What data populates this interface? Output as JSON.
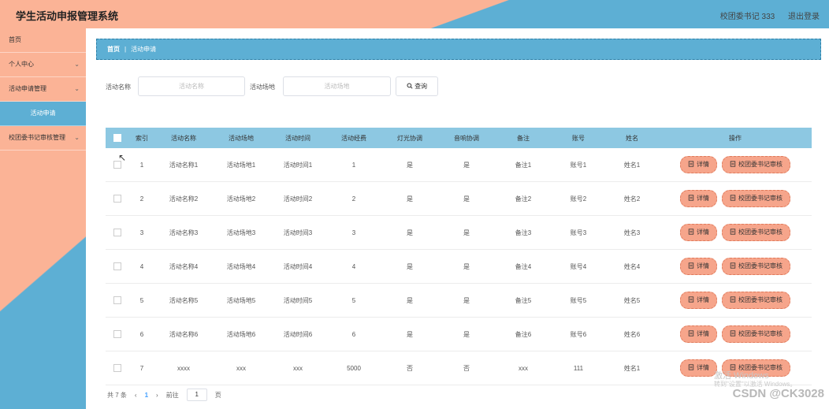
{
  "header": {
    "title": "学生活动申报管理系统",
    "user": "校团委书记 333",
    "logout": "退出登录"
  },
  "sidebar": {
    "items": [
      {
        "label": "首页",
        "chevron": ""
      },
      {
        "label": "个人中心",
        "chevron": "⌄"
      },
      {
        "label": "活动申请管理",
        "chevron": "⌄"
      },
      {
        "label": "活动申请",
        "chevron": ""
      },
      {
        "label": "校团委书记审核管理",
        "chevron": "⌄"
      }
    ]
  },
  "breadcrumb": {
    "home": "首页",
    "sep": "|",
    "current": "活动申请"
  },
  "search": {
    "name_label": "活动名称",
    "name_placeholder": "活动名称",
    "venue_label": "活动场地",
    "venue_placeholder": "活动场地",
    "query_icon": "search-icon",
    "query_label": "查询"
  },
  "table": {
    "headers": [
      "索引",
      "活动名称",
      "活动场地",
      "活动时间",
      "活动经费",
      "灯光协调",
      "音响协调",
      "备注",
      "账号",
      "姓名",
      "操作"
    ],
    "rows": [
      [
        "1",
        "活动名称1",
        "活动场地1",
        "活动时间1",
        "1",
        "是",
        "是",
        "备注1",
        "账号1",
        "姓名1"
      ],
      [
        "2",
        "活动名称2",
        "活动场地2",
        "活动时间2",
        "2",
        "是",
        "是",
        "备注2",
        "账号2",
        "姓名2"
      ],
      [
        "3",
        "活动名称3",
        "活动场地3",
        "活动时间3",
        "3",
        "是",
        "是",
        "备注3",
        "账号3",
        "姓名3"
      ],
      [
        "4",
        "活动名称4",
        "活动场地4",
        "活动时间4",
        "4",
        "是",
        "是",
        "备注4",
        "账号4",
        "姓名4"
      ],
      [
        "5",
        "活动名称5",
        "活动场地5",
        "活动时间5",
        "5",
        "是",
        "是",
        "备注5",
        "账号5",
        "姓名5"
      ],
      [
        "6",
        "活动名称6",
        "活动场地6",
        "活动时间6",
        "6",
        "是",
        "是",
        "备注6",
        "账号6",
        "姓名6"
      ],
      [
        "7",
        "xxxx",
        "xxx",
        "xxx",
        "5000",
        "否",
        "否",
        "xxx",
        "111",
        "姓名1"
      ]
    ],
    "detail_label": "详情",
    "audit_label": "校团委书记审核",
    "detail_icon": "document-icon",
    "audit_icon": "document-icon"
  },
  "pagination": {
    "total": "共 7 条",
    "prev": "‹",
    "page": "1",
    "next": "›",
    "goto": "前往",
    "goto_value": "1",
    "unit": "页"
  },
  "watermark": {
    "line1": "激活 Windows",
    "line2": "转到\"设置\"以激活 Windows。",
    "line3": "CSDN @CK3028"
  },
  "colors": {
    "salmon": "#fbb396",
    "blue": "#5dafd4",
    "header_row": "#8dc8e2",
    "button": "#f6a58b"
  }
}
